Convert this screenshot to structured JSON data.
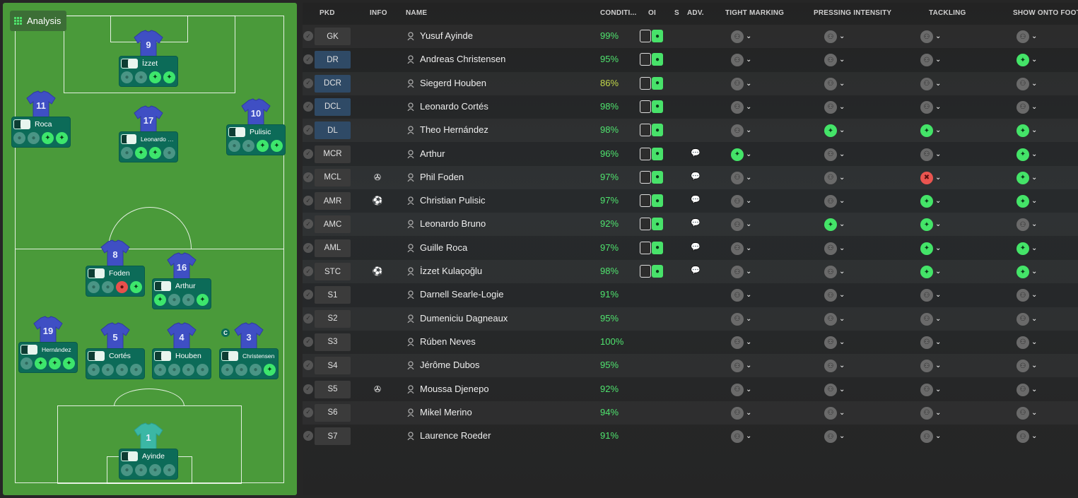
{
  "analysis_label": "Analysis",
  "captain_mark": "C",
  "headers": {
    "pkd": "PKD",
    "info": "INFO",
    "name": "NAME",
    "condition": "CONDITI...",
    "oi": "OI",
    "s": "S",
    "adv": "ADV.",
    "tight_marking": "TIGHT MARKING",
    "pressing": "PRESSING INTENSITY",
    "tackling": "TACKLING",
    "show_onto_foot": "SHOW ONTO FOOT"
  },
  "pitch_players": [
    {
      "number": "9",
      "name": "İzzet",
      "kit": "blue",
      "icons": [
        "dim",
        "dim",
        "on",
        "on"
      ]
    },
    {
      "number": "11",
      "name": "Roca",
      "kit": "blue",
      "icons": [
        "dim",
        "dim",
        "on",
        "on"
      ]
    },
    {
      "number": "17",
      "name": "Leonardo Bru...",
      "kit": "blue",
      "small": true,
      "icons": [
        "dim",
        "on",
        "on",
        "dim"
      ]
    },
    {
      "number": "10",
      "name": "Pulisic",
      "kit": "blue",
      "icons": [
        "dim",
        "dim",
        "on",
        "on"
      ]
    },
    {
      "number": "8",
      "name": "Foden",
      "kit": "blue",
      "icons": [
        "dim",
        "dim",
        "red",
        "on"
      ]
    },
    {
      "number": "16",
      "name": "Arthur",
      "kit": "blue",
      "icons": [
        "on",
        "dim",
        "dim",
        "on"
      ]
    },
    {
      "number": "19",
      "name": "Hernández",
      "kit": "blue",
      "small": true,
      "icons": [
        "dim",
        "on",
        "on",
        "on"
      ]
    },
    {
      "number": "5",
      "name": "Cortés",
      "kit": "blue",
      "icons": [
        "dim",
        "dim",
        "dim",
        "dim"
      ]
    },
    {
      "number": "4",
      "name": "Houben",
      "kit": "blue",
      "icons": [
        "dim",
        "dim",
        "dim",
        "dim"
      ]
    },
    {
      "number": "3",
      "name": "Christensen",
      "kit": "blue",
      "small": true,
      "icons": [
        "dim",
        "dim",
        "dim",
        "on"
      ]
    },
    {
      "number": "1",
      "name": "Ayinde",
      "kit": "teal",
      "icons": [
        "dim",
        "dim",
        "dim",
        "dim"
      ]
    }
  ],
  "rows": [
    {
      "pos": "GK",
      "blue": false,
      "info": "",
      "name": "Yusuf Ayinde",
      "cond": "99%",
      "oi": true,
      "adv": false,
      "tm": "off",
      "pi": "off",
      "tk": "off",
      "sf": "off"
    },
    {
      "pos": "DR",
      "blue": true,
      "info": "",
      "name": "Andreas Christensen",
      "cond": "95%",
      "oi": true,
      "adv": false,
      "tm": "off",
      "pi": "off",
      "tk": "off",
      "sf": "on"
    },
    {
      "pos": "DCR",
      "blue": true,
      "info": "",
      "name": "Siegerd Houben",
      "cond": "86%",
      "oi": true,
      "adv": false,
      "tm": "off",
      "pi": "off",
      "tk": "off",
      "sf": "off"
    },
    {
      "pos": "DCL",
      "blue": true,
      "info": "",
      "name": "Leonardo Cortés",
      "cond": "98%",
      "oi": true,
      "adv": false,
      "tm": "off",
      "pi": "off",
      "tk": "off",
      "sf": "off"
    },
    {
      "pos": "DL",
      "blue": true,
      "info": "",
      "name": "Theo Hernández",
      "cond": "98%",
      "oi": true,
      "adv": false,
      "tm": "off",
      "pi": "on",
      "tk": "on",
      "sf": "on"
    },
    {
      "pos": "MCR",
      "blue": false,
      "info": "",
      "name": "Arthur",
      "cond": "96%",
      "oi": true,
      "adv": true,
      "tm": "on",
      "pi": "off",
      "tk": "off",
      "sf": "on"
    },
    {
      "pos": "MCL",
      "blue": false,
      "info": "ball2",
      "name": "Phil Foden",
      "cond": "97%",
      "oi": true,
      "adv": true,
      "tm": "off",
      "pi": "off",
      "tk": "red",
      "sf": "on"
    },
    {
      "pos": "AMR",
      "blue": false,
      "info": "ball",
      "name": "Christian Pulisic",
      "cond": "97%",
      "oi": true,
      "adv": true,
      "tm": "off",
      "pi": "off",
      "tk": "on",
      "sf": "on"
    },
    {
      "pos": "AMC",
      "blue": false,
      "info": "",
      "name": "Leonardo Bruno",
      "cond": "92%",
      "oi": true,
      "adv": true,
      "tm": "off",
      "pi": "on",
      "tk": "on",
      "sf": "off"
    },
    {
      "pos": "AML",
      "blue": false,
      "info": "",
      "name": "Guille Roca",
      "cond": "97%",
      "oi": true,
      "adv": true,
      "tm": "off",
      "pi": "off",
      "tk": "on",
      "sf": "on"
    },
    {
      "pos": "STC",
      "blue": false,
      "info": "ball",
      "name": "İzzet Kulaçoğlu",
      "cond": "98%",
      "oi": true,
      "adv": true,
      "tm": "off",
      "pi": "off",
      "tk": "on",
      "sf": "on"
    },
    {
      "pos": "S1",
      "blue": false,
      "info": "",
      "name": "Darnell Searle-Logie",
      "cond": "91%",
      "oi": false,
      "adv": false,
      "tm": "off",
      "pi": "off",
      "tk": "off",
      "sf": "off"
    },
    {
      "pos": "S2",
      "blue": false,
      "info": "",
      "name": "Dumeniciu Dagneaux",
      "cond": "95%",
      "oi": false,
      "adv": false,
      "tm": "off",
      "pi": "off",
      "tk": "off",
      "sf": "off"
    },
    {
      "pos": "S3",
      "blue": false,
      "info": "",
      "name": "Rúben Neves",
      "cond": "100%",
      "oi": false,
      "adv": false,
      "tm": "off",
      "pi": "off",
      "tk": "off",
      "sf": "off"
    },
    {
      "pos": "S4",
      "blue": false,
      "info": "",
      "name": "Jérôme Dubos",
      "cond": "95%",
      "oi": false,
      "adv": false,
      "tm": "off",
      "pi": "off",
      "tk": "off",
      "sf": "off"
    },
    {
      "pos": "S5",
      "blue": false,
      "info": "ball2",
      "name": "Moussa Djenepo",
      "cond": "92%",
      "oi": false,
      "adv": false,
      "tm": "off",
      "pi": "off",
      "tk": "off",
      "sf": "off"
    },
    {
      "pos": "S6",
      "blue": false,
      "info": "",
      "name": "Mikel Merino",
      "cond": "94%",
      "oi": false,
      "adv": false,
      "tm": "off",
      "pi": "off",
      "tk": "off",
      "sf": "off"
    },
    {
      "pos": "S7",
      "blue": false,
      "info": "",
      "name": "Laurence Roeder",
      "cond": "91%",
      "oi": false,
      "adv": false,
      "tm": "off",
      "pi": "off",
      "tk": "off",
      "sf": "off"
    }
  ],
  "colors": {
    "on": "#44e468",
    "red": "#ea5550",
    "pitch": "#4a9a3a",
    "card": "#0c6b58"
  }
}
